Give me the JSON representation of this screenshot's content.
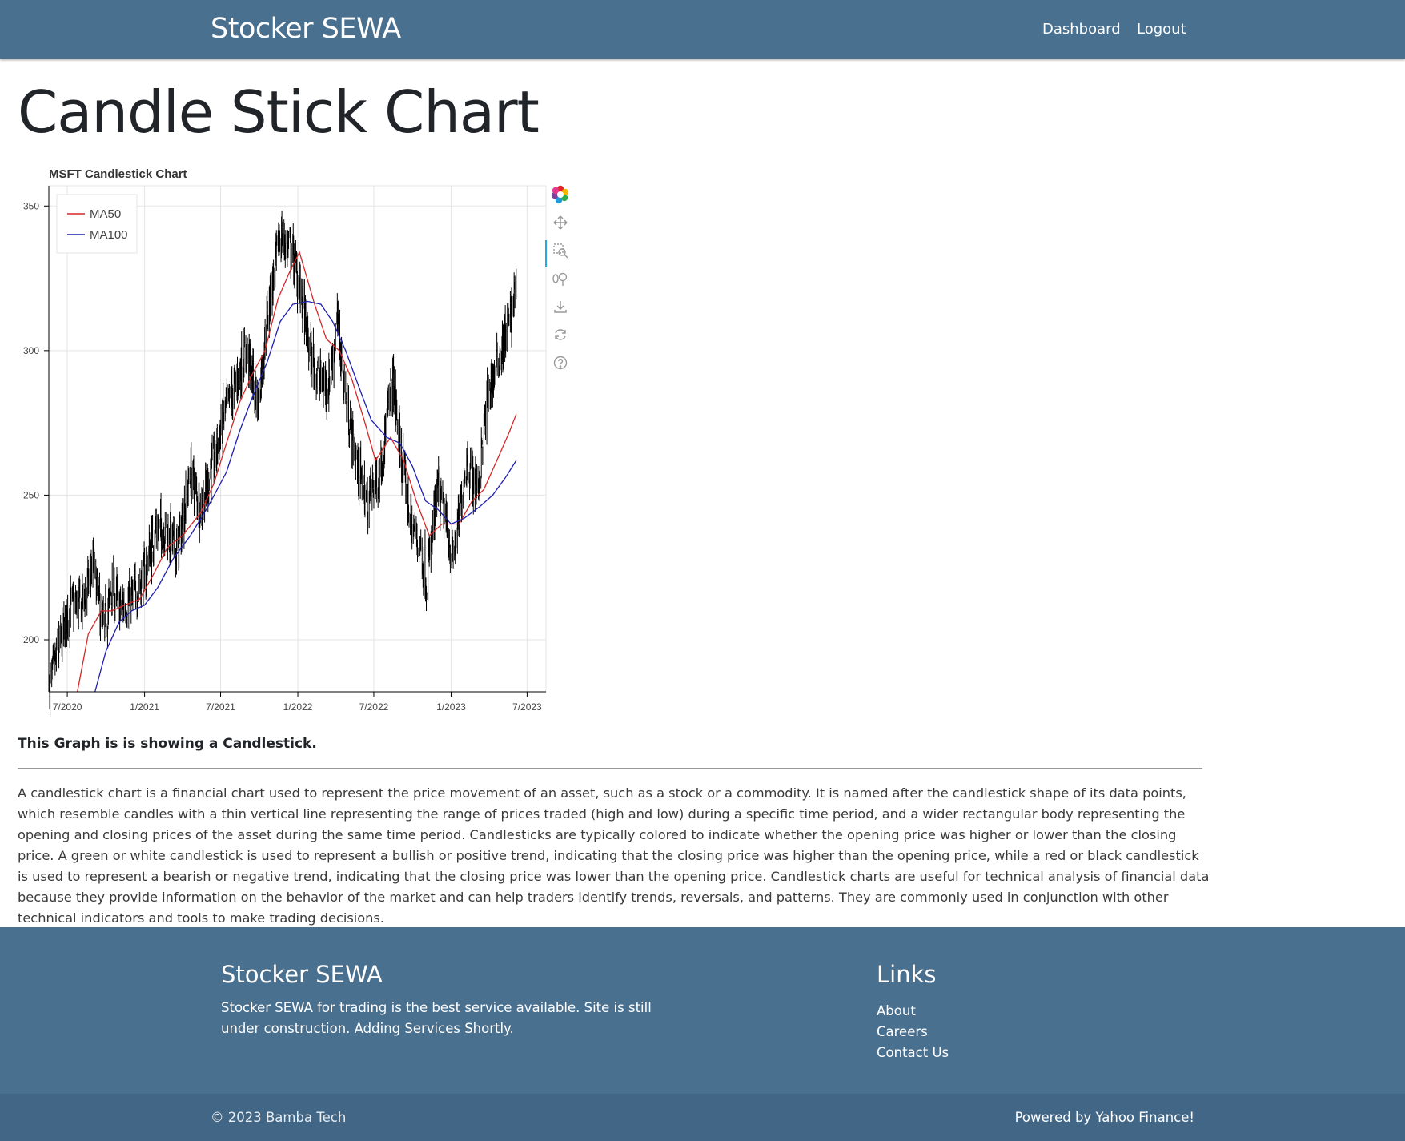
{
  "nav": {
    "brand": "Stocker SEWA",
    "links": [
      "Dashboard",
      "Logout"
    ]
  },
  "page": {
    "title": "Candle Stick Chart",
    "caption": "This Graph is is showing a Candlestick.",
    "description": "A candlestick chart is a financial chart used to represent the price movement of an asset, such as a stock or a commodity. It is named after the candlestick shape of its data points, which resemble candles with a thin vertical line representing the range of prices traded (high and low) during a specific time period, and a wider rectangular body representing the opening and closing prices of the asset during the same time period. Candlesticks are typically colored to indicate whether the opening price was higher or lower than the closing price. A green or white candlestick is used to represent a bullish or positive trend, indicating that the closing price was higher than the opening price, while a red or black candlestick is used to represent a bearish or negative trend, indicating that the closing price was lower than the opening price. Candlestick charts are useful for technical analysis of financial data because they provide information on the behavior of the market and can help traders identify trends, reversals, and patterns. They are commonly used in conjunction with other technical indicators and tools to make trading decisions."
  },
  "toolbar": {
    "tools": [
      "bokeh-logo-icon",
      "pan-icon",
      "box-zoom-icon",
      "wheel-zoom-icon",
      "save-icon",
      "reset-icon",
      "help-icon"
    ]
  },
  "chart_data": {
    "type": "candlestick",
    "title": "MSFT Candlestick Chart",
    "x_ticks": [
      "7/2020",
      "1/2021",
      "7/2021",
      "1/2022",
      "7/2022",
      "1/2023",
      "7/2023"
    ],
    "y_ticks": [
      200,
      250,
      300,
      350
    ],
    "xlim": [
      "2020-05-18",
      "2023-08-15"
    ],
    "ylim": [
      182,
      357
    ],
    "grid": true,
    "legend_position": "top-left",
    "candle_color": "#000000",
    "price_path": [
      [
        "2020-05-20",
        184
      ],
      [
        "2020-06-10",
        196
      ],
      [
        "2020-07-08",
        212
      ],
      [
        "2020-08-05",
        212
      ],
      [
        "2020-09-01",
        226
      ],
      [
        "2020-09-25",
        203
      ],
      [
        "2020-10-15",
        218
      ],
      [
        "2020-11-05",
        211
      ],
      [
        "2020-12-01",
        214
      ],
      [
        "2020-12-30",
        222
      ],
      [
        "2021-01-25",
        238
      ],
      [
        "2021-02-20",
        238
      ],
      [
        "2021-03-20",
        230
      ],
      [
        "2021-04-20",
        258
      ],
      [
        "2021-05-15",
        245
      ],
      [
        "2021-06-15",
        262
      ],
      [
        "2021-07-10",
        278
      ],
      [
        "2021-08-05",
        288
      ],
      [
        "2021-09-01",
        300
      ],
      [
        "2021-09-28",
        282
      ],
      [
        "2021-10-20",
        312
      ],
      [
        "2021-11-20",
        340
      ],
      [
        "2021-12-20",
        333
      ],
      [
        "2022-01-10",
        318
      ],
      [
        "2022-01-28",
        300
      ],
      [
        "2022-02-20",
        290
      ],
      [
        "2022-03-15",
        288
      ],
      [
        "2022-04-05",
        310
      ],
      [
        "2022-04-28",
        280
      ],
      [
        "2022-05-25",
        258
      ],
      [
        "2022-06-15",
        248
      ],
      [
        "2022-07-15",
        258
      ],
      [
        "2022-08-15",
        290
      ],
      [
        "2022-09-05",
        262
      ],
      [
        "2022-09-28",
        240
      ],
      [
        "2022-10-20",
        232
      ],
      [
        "2022-11-03",
        220
      ],
      [
        "2022-11-30",
        252
      ],
      [
        "2022-12-20",
        240
      ],
      [
        "2023-01-05",
        228
      ],
      [
        "2023-01-20",
        242
      ],
      [
        "2023-02-05",
        262
      ],
      [
        "2023-03-05",
        252
      ],
      [
        "2023-03-30",
        285
      ],
      [
        "2023-04-25",
        298
      ],
      [
        "2023-05-20",
        310
      ],
      [
        "2023-06-05",
        322
      ]
    ],
    "series": [
      {
        "name": "MA50",
        "color": "#d62728",
        "points": [
          [
            "2020-07-25",
            182
          ],
          [
            "2020-08-20",
            202
          ],
          [
            "2020-09-20",
            210
          ],
          [
            "2020-10-15",
            210
          ],
          [
            "2020-11-15",
            212
          ],
          [
            "2020-12-20",
            214
          ],
          [
            "2021-01-20",
            222
          ],
          [
            "2021-02-25",
            232
          ],
          [
            "2021-04-01",
            236
          ],
          [
            "2021-05-15",
            244
          ],
          [
            "2021-06-15",
            254
          ],
          [
            "2021-07-15",
            268
          ],
          [
            "2021-08-15",
            282
          ],
          [
            "2021-09-15",
            292
          ],
          [
            "2021-10-15",
            300
          ],
          [
            "2021-11-15",
            318
          ],
          [
            "2021-12-15",
            328
          ],
          [
            "2022-01-05",
            334
          ],
          [
            "2022-02-10",
            316
          ],
          [
            "2022-03-10",
            304
          ],
          [
            "2022-04-10",
            300
          ],
          [
            "2022-05-10",
            290
          ],
          [
            "2022-06-10",
            275
          ],
          [
            "2022-07-05",
            262
          ],
          [
            "2022-08-10",
            270
          ],
          [
            "2022-09-10",
            262
          ],
          [
            "2022-10-10",
            248
          ],
          [
            "2022-11-10",
            236
          ],
          [
            "2022-12-10",
            240
          ],
          [
            "2023-01-20",
            240
          ],
          [
            "2023-02-20",
            248
          ],
          [
            "2023-03-20",
            252
          ],
          [
            "2023-04-20",
            262
          ],
          [
            "2023-05-20",
            272
          ],
          [
            "2023-06-05",
            278
          ]
        ]
      },
      {
        "name": "MA100",
        "color": "#1f1fb4",
        "points": [
          [
            "2020-09-05",
            182
          ],
          [
            "2020-10-01",
            196
          ],
          [
            "2020-11-01",
            206
          ],
          [
            "2020-12-01",
            210
          ],
          [
            "2021-01-01",
            212
          ],
          [
            "2021-02-01",
            218
          ],
          [
            "2021-03-10",
            228
          ],
          [
            "2021-04-20",
            236
          ],
          [
            "2021-06-01",
            246
          ],
          [
            "2021-07-15",
            258
          ],
          [
            "2021-08-15",
            272
          ],
          [
            "2021-09-15",
            284
          ],
          [
            "2021-10-20",
            296
          ],
          [
            "2021-11-20",
            310
          ],
          [
            "2021-12-20",
            316
          ],
          [
            "2022-01-25",
            317
          ],
          [
            "2022-02-25",
            316
          ],
          [
            "2022-03-25",
            310
          ],
          [
            "2022-04-25",
            300
          ],
          [
            "2022-05-25",
            288
          ],
          [
            "2022-06-25",
            276
          ],
          [
            "2022-08-01",
            270
          ],
          [
            "2022-09-01",
            268
          ],
          [
            "2022-10-01",
            260
          ],
          [
            "2022-11-01",
            248
          ],
          [
            "2022-12-01",
            245
          ],
          [
            "2023-01-01",
            240
          ],
          [
            "2023-02-01",
            242
          ],
          [
            "2023-03-10",
            246
          ],
          [
            "2023-04-10",
            250
          ],
          [
            "2023-05-10",
            256
          ],
          [
            "2023-06-05",
            262
          ]
        ]
      }
    ]
  },
  "footer": {
    "brand": "Stocker SEWA",
    "text": "Stocker SEWA for trading is the best service available. Site is still under construction. Adding Services Shortly.",
    "links_title": "Links",
    "links": [
      "About",
      "Careers",
      "Contact Us"
    ],
    "copyright": "© 2023 Bamba Tech",
    "powered": "Powered by Yahoo Finance!"
  }
}
